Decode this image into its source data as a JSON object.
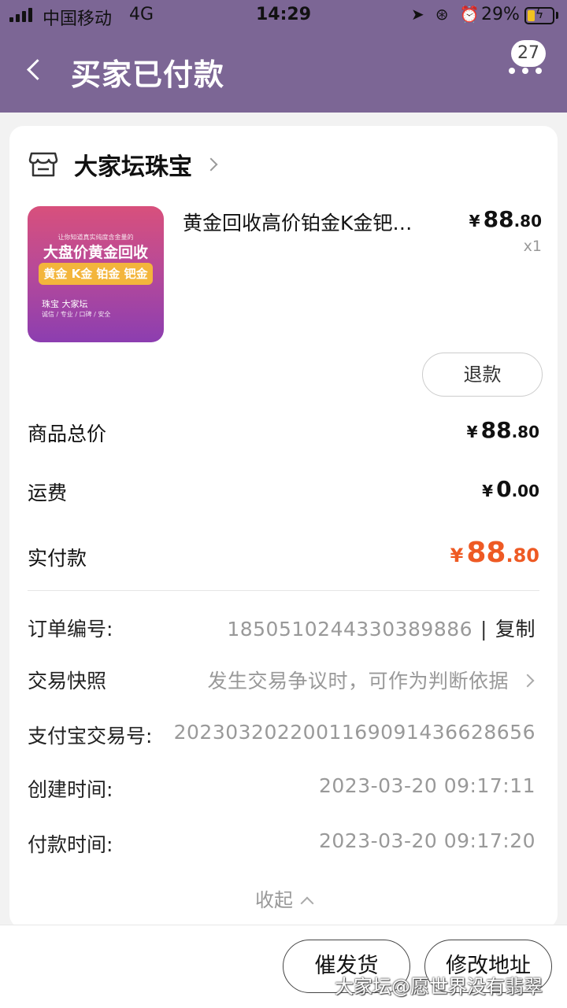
{
  "status_bar": {
    "carrier": "中国移动",
    "network": "4G",
    "time": "14:29",
    "battery_percent": "29%",
    "battery_level": 0.29
  },
  "header": {
    "title": "买家已付款",
    "badge_count": "27"
  },
  "shop": {
    "name": "大家坛珠宝"
  },
  "product": {
    "image_texts": {
      "top_small": "让你知道真实纯度含金量的",
      "headline": "大盘价黄金回收",
      "tag": "黄金 K金 铂金 钯金",
      "brand": "珠宝 大家坛",
      "slogan": "诚信 / 专业 / 口碑 / 安全"
    },
    "title": "黄金回收高价铂金K金钯…",
    "price_symbol": "¥",
    "price_int": "88",
    "price_dec": ".80",
    "quantity": "x1",
    "refund_label": "退款"
  },
  "summary": {
    "goods_total_label": "商品总价",
    "goods_total": {
      "sym": "¥",
      "int": "88",
      "dec": ".80"
    },
    "shipping_label": "运费",
    "shipping": {
      "sym": "¥",
      "int": "0",
      "dec": ".00"
    },
    "paid_label": "实付款",
    "paid": {
      "sym": "¥",
      "int": "88",
      "dec": ".80"
    }
  },
  "info": {
    "order_no_label": "订单编号:",
    "order_no": "1850510244330389886",
    "separator": "|",
    "copy_label": "复制",
    "snapshot_label": "交易快照",
    "snapshot_value": "发生交易争议时，可作为判断依据",
    "alipay_no_label": "支付宝交易号:",
    "alipay_no": "2023032022001169091436628656",
    "created_label": "创建时间:",
    "created_time": "2023-03-20 09:17:11",
    "paid_time_label": "付款时间:",
    "paid_time": "2023-03-20 09:17:20",
    "collapse_label": "收起"
  },
  "bottom": {
    "urge_label": "催发货",
    "address_label": "修改地址",
    "watermark": "大家坛@愿世界没有翡翠"
  },
  "colors": {
    "header_bg": "#7c6695",
    "accent_price": "#ee5a24",
    "page_bg": "#f2f2f2"
  }
}
